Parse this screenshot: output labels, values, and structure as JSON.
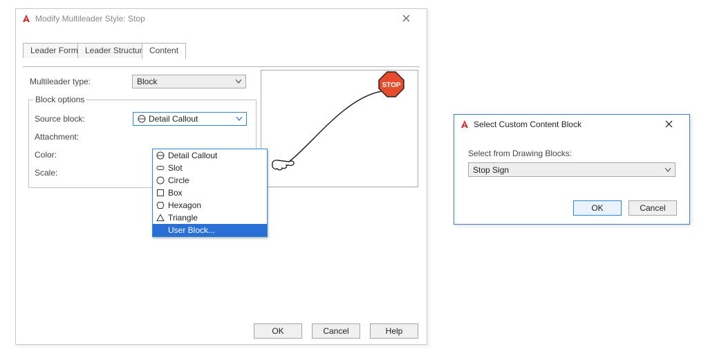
{
  "main_dialog": {
    "title": "Modify Multileader Style: Stop",
    "tabs": {
      "leader_format": "Leader Format",
      "leader_structure": "Leader Structure",
      "content": "Content"
    },
    "active_tab": "content",
    "fields": {
      "multileader_type_label": "Multileader type:",
      "multileader_type_value": "Block",
      "groupbox": "Block options",
      "source_block_label": "Source block:",
      "source_block_value": "Detail Callout",
      "attachment_label": "Attachment:",
      "color_label": "Color:",
      "scale_label": "Scale:"
    },
    "dropdown_items": [
      {
        "icon": "detail-callout-icon",
        "label": "Detail Callout"
      },
      {
        "icon": "slot-icon",
        "label": "Slot"
      },
      {
        "icon": "circle-icon",
        "label": "Circle"
      },
      {
        "icon": "box-icon",
        "label": "Box"
      },
      {
        "icon": "hexagon-icon",
        "label": "Hexagon"
      },
      {
        "icon": "triangle-icon",
        "label": "Triangle"
      },
      {
        "icon": "none",
        "label": "User Block..."
      }
    ],
    "dropdown_highlighted": 6,
    "buttons": {
      "ok": "OK",
      "cancel": "Cancel",
      "help": "Help"
    }
  },
  "select_dialog": {
    "title": "Select Custom Content Block",
    "prompt": "Select from Drawing Blocks:",
    "value": "Stop Sign",
    "buttons": {
      "ok": "OK",
      "cancel": "Cancel"
    }
  }
}
